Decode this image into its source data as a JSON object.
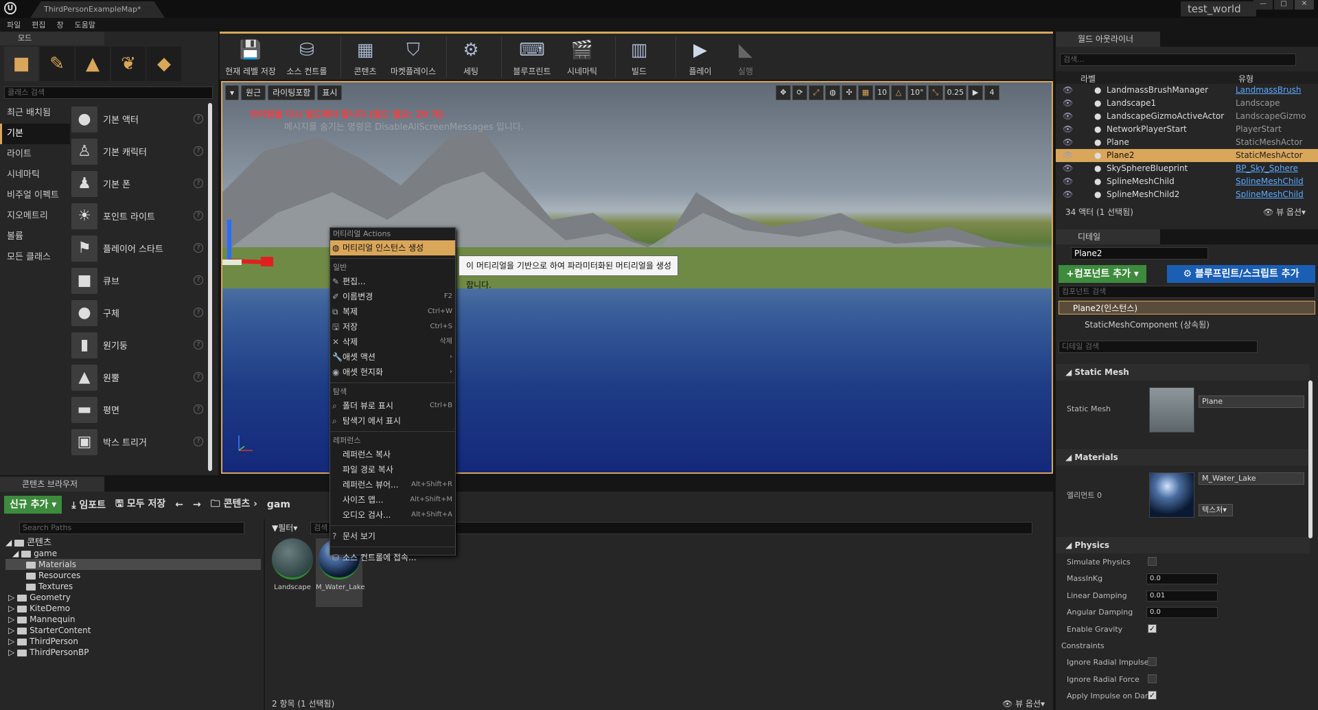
{
  "window": {
    "doc_tab": "ThirdPersonExampleMap*",
    "project_name": "test_world",
    "controls": [
      "—",
      "□",
      "✕"
    ]
  },
  "menu": [
    "파일",
    "편집",
    "창",
    "도움말"
  ],
  "modes": {
    "tab": "모드",
    "search_placeholder": "클래스 검색",
    "categories": [
      "최근 배치됨",
      "기본",
      "라이트",
      "시네마틱",
      "비주얼 이펙트",
      "지오메트리",
      "볼륨",
      "모든 클래스"
    ],
    "active_category": "기본",
    "items": [
      "기본 액터",
      "기본 캐릭터",
      "기본 폰",
      "포인트 라이트",
      "플레이어 스타트",
      "큐브",
      "구체",
      "원기둥",
      "원뿔",
      "평면",
      "박스 트리거"
    ]
  },
  "toolbar": {
    "buttons": [
      "현재 레벨 저장",
      "소스 컨트롤",
      "콘텐츠",
      "마켓플레이스",
      "세팅",
      "블루프린트",
      "시네마틱",
      "빌드",
      "플레이",
      "실행"
    ]
  },
  "viewport": {
    "left_buttons": [
      "▾",
      "원근",
      "라이팅포함",
      "표시"
    ],
    "right_values": [
      "10",
      "10°",
      "0.25",
      "4"
    ],
    "warning": "라이팅을 다시 빌드해야 합니다 (빌드 필요: 29 개)",
    "hint": "메시지를 숨기는 명령은 DisableAllScreenMessages 입니다."
  },
  "context_menu": {
    "header_actions": "머티리얼 Actions",
    "create_instance": "머티리얼 인스턴스 생성",
    "header_general": "일반",
    "general": [
      {
        "label": "편집...",
        "shortcut": ""
      },
      {
        "label": "이름변경",
        "shortcut": "F2"
      },
      {
        "label": "복제",
        "shortcut": "Ctrl+W"
      },
      {
        "label": "저장",
        "shortcut": "Ctrl+S"
      },
      {
        "label": "삭제",
        "shortcut": "삭제"
      },
      {
        "label": "애셋 액션",
        "shortcut": "›"
      },
      {
        "label": "애셋 현지화",
        "shortcut": "›"
      }
    ],
    "header_explore": "탐색",
    "explore": [
      {
        "label": "폴더 뷰로 표시",
        "shortcut": "Ctrl+B"
      },
      {
        "label": "탐색기 에서 표시",
        "shortcut": ""
      }
    ],
    "header_refs": "레퍼런스",
    "refs": [
      {
        "label": "레퍼런스 복사",
        "shortcut": ""
      },
      {
        "label": "파일 경로 복사",
        "shortcut": ""
      },
      {
        "label": "레퍼런스 뷰어...",
        "shortcut": "Alt+Shift+R"
      },
      {
        "label": "사이즈 맵...",
        "shortcut": "Alt+Shift+M"
      },
      {
        "label": "오디오 검사...",
        "shortcut": "Alt+Shift+A"
      }
    ],
    "docs": "문서 보기",
    "source_control": "소스 컨트롤에 접속...",
    "tooltip": "이 머티리얼을 기반으로 하여 파라미터화된 머티리얼을 생성합니다."
  },
  "content_browser": {
    "tab": "콘텐츠 브라우저",
    "add_new": "신규 추가",
    "import": "임포트",
    "save_all": "모두 저장",
    "path_root": "콘텐츠",
    "path_sub": "gam",
    "paths_placeholder": "Search Paths",
    "filter": "필터",
    "asset_search_placeholder": "검색",
    "tree": [
      {
        "label": "콘텐츠",
        "depth": 0,
        "open": "◢"
      },
      {
        "label": "game",
        "depth": 1,
        "open": "◢"
      },
      {
        "label": "Materials",
        "depth": 2,
        "open": ""
      },
      {
        "label": "Resources",
        "depth": 2,
        "open": ""
      },
      {
        "label": "Textures",
        "depth": 2,
        "open": ""
      },
      {
        "label": "Geometry",
        "depth": 1,
        "open": "▷"
      },
      {
        "label": "KiteDemo",
        "depth": 1,
        "open": "▷"
      },
      {
        "label": "Mannequin",
        "depth": 1,
        "open": "▷"
      },
      {
        "label": "StarterContent",
        "depth": 1,
        "open": "▷"
      },
      {
        "label": "ThirdPerson",
        "depth": 1,
        "open": "▷"
      },
      {
        "label": "ThirdPersonBP",
        "depth": 1,
        "open": "▷"
      }
    ],
    "assets": [
      "Landscape",
      "M_Water_Lake"
    ],
    "count": "2 항목 (1 선택됨)",
    "view_options": "뷰 옵션"
  },
  "world_outliner": {
    "tab": "월드 아웃라이너",
    "search_placeholder": "검색...",
    "col_label": "라벨",
    "col_type": "유형",
    "rows": [
      {
        "name": "LandmassBrushManager",
        "type": "LandmassBrush",
        "link": true
      },
      {
        "name": "Landscape1",
        "type": "Landscape",
        "link": false
      },
      {
        "name": "LandscapeGizmoActiveActor",
        "type": "LandscapeGizmo",
        "link": false
      },
      {
        "name": "NetworkPlayerStart",
        "type": "PlayerStart",
        "link": false
      },
      {
        "name": "Plane",
        "type": "StaticMeshActor",
        "link": false
      },
      {
        "name": "Plane2",
        "type": "StaticMeshActor",
        "link": false
      },
      {
        "name": "SkySphereBlueprint",
        "type": "BP_Sky_Sphere",
        "link": true
      },
      {
        "name": "SplineMeshChild",
        "type": "SplineMeshChild",
        "link": true
      },
      {
        "name": "SplineMeshChild2",
        "type": "SplineMeshChild",
        "link": true
      }
    ],
    "selected_row": 5,
    "count": "34 액터 (1 선택됨)",
    "view_options": "뷰 옵션"
  },
  "details": {
    "tab": "디테일",
    "object_name": "Plane2",
    "add_component": "컴포넌트 추가",
    "add_blueprint": "블루프린트/스크립트 추가",
    "comp_search_placeholder": "컴포넌트 검색",
    "instance": "Plane2(인스턴스)",
    "component": "StaticMeshComponent (상속됨)",
    "detail_search_placeholder": "디테일 검색",
    "sec_static_mesh": "Static Mesh",
    "static_mesh_label": "Static Mesh",
    "static_mesh_value": "Plane",
    "sec_materials": "Materials",
    "element0_label": "엘리먼트 0",
    "material_value": "M_Water_Lake",
    "texture_btn": "텍스처",
    "sec_physics": "Physics",
    "physics": [
      {
        "label": "Simulate Physics",
        "kind": "check",
        "value": false
      },
      {
        "label": "MassInKg",
        "kind": "value",
        "value": "0.0"
      },
      {
        "label": "Linear Damping",
        "kind": "value",
        "value": "0.01"
      },
      {
        "label": "Angular Damping",
        "kind": "value",
        "value": "0.0"
      },
      {
        "label": "Enable Gravity",
        "kind": "check",
        "value": true
      },
      {
        "label": "Constraints",
        "kind": "group",
        "value": ""
      },
      {
        "label": "Ignore Radial Impulse",
        "kind": "check",
        "value": false
      },
      {
        "label": "Ignore Radial Force",
        "kind": "check",
        "value": false
      },
      {
        "label": "Apply Impulse on Dam",
        "kind": "check",
        "value": true
      }
    ]
  }
}
